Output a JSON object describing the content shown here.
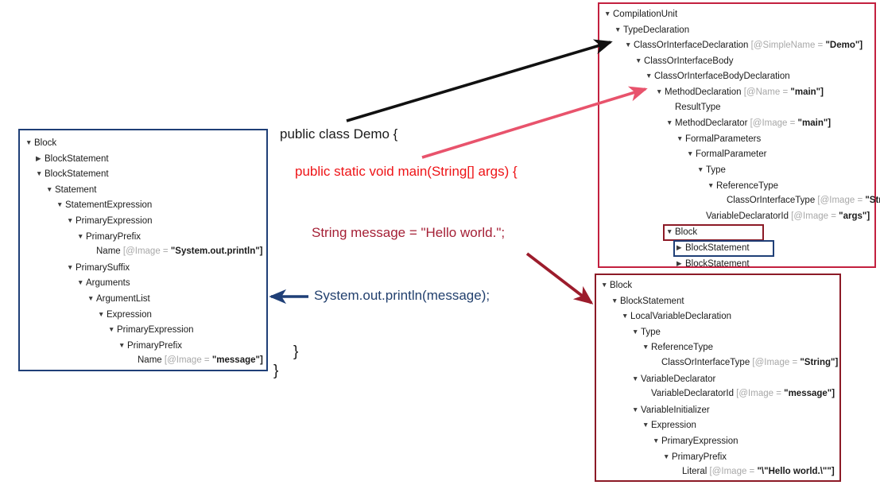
{
  "code_snippet": {
    "lines": [
      {
        "id": "line-class-decl",
        "text": "public class Demo {",
        "color": "#1b1b1b"
      },
      {
        "id": "line-main-method",
        "text": "public static void main(String[] args) {",
        "color": "#ee1417"
      },
      {
        "id": "line-string-message",
        "text": "String message = \"Hello world.\";",
        "color": "#a52036"
      },
      {
        "id": "line-println",
        "text": "System.out.println(message);",
        "color": "#22406e"
      },
      {
        "id": "line-close-inner",
        "text": "}",
        "color": "#1b1b1b"
      },
      {
        "id": "line-close-outer",
        "text": "}",
        "color": "#1b1b1b"
      }
    ]
  },
  "panels": {
    "left_block_tree": {
      "border_color": "#1f3f77",
      "rows": [
        {
          "indent": 0,
          "twisty": "expanded",
          "name": "Block",
          "attr": "",
          "value": ""
        },
        {
          "indent": 1,
          "twisty": "collapsed",
          "name": "BlockStatement",
          "attr": "",
          "value": ""
        },
        {
          "indent": 1,
          "twisty": "expanded",
          "name": "BlockStatement",
          "attr": "",
          "value": ""
        },
        {
          "indent": 2,
          "twisty": "expanded",
          "name": "Statement",
          "attr": "",
          "value": ""
        },
        {
          "indent": 3,
          "twisty": "expanded",
          "name": "StatementExpression",
          "attr": "",
          "value": ""
        },
        {
          "indent": 4,
          "twisty": "expanded",
          "name": "PrimaryExpression",
          "attr": "",
          "value": ""
        },
        {
          "indent": 5,
          "twisty": "expanded",
          "name": "PrimaryPrefix",
          "attr": "",
          "value": ""
        },
        {
          "indent": 6,
          "twisty": "none",
          "name": "Name",
          "attr": "[@Image = ",
          "value": "\"System.out.println\"]"
        },
        {
          "indent": 4,
          "twisty": "expanded",
          "name": "PrimarySuffix",
          "attr": "",
          "value": ""
        },
        {
          "indent": 5,
          "twisty": "expanded",
          "name": "Arguments",
          "attr": "",
          "value": ""
        },
        {
          "indent": 6,
          "twisty": "expanded",
          "name": "ArgumentList",
          "attr": "",
          "value": ""
        },
        {
          "indent": 7,
          "twisty": "expanded",
          "name": "Expression",
          "attr": "",
          "value": ""
        },
        {
          "indent": 8,
          "twisty": "expanded",
          "name": "PrimaryExpression",
          "attr": "",
          "value": ""
        },
        {
          "indent": 9,
          "twisty": "expanded",
          "name": "PrimaryPrefix",
          "attr": "",
          "value": ""
        },
        {
          "indent": 10,
          "twisty": "none",
          "name": "Name",
          "attr": "[@Image = ",
          "value": "\"message\"]"
        }
      ]
    },
    "top_right_compilation_unit": {
      "border_color": "#c3203f",
      "rows": [
        {
          "indent": 0,
          "twisty": "expanded",
          "name": "CompilationUnit",
          "attr": "",
          "value": ""
        },
        {
          "indent": 1,
          "twisty": "expanded",
          "name": "TypeDeclaration",
          "attr": "",
          "value": ""
        },
        {
          "indent": 2,
          "twisty": "expanded",
          "name": "ClassOrInterfaceDeclaration",
          "attr": "[@SimpleName = ",
          "value": "\"Demo\"]"
        },
        {
          "indent": 3,
          "twisty": "expanded",
          "name": "ClassOrInterfaceBody",
          "attr": "",
          "value": ""
        },
        {
          "indent": 4,
          "twisty": "expanded",
          "name": "ClassOrInterfaceBodyDeclaration",
          "attr": "",
          "value": ""
        },
        {
          "indent": 5,
          "twisty": "expanded",
          "name": "MethodDeclaration",
          "attr": "[@Name = ",
          "value": "\"main\"]"
        },
        {
          "indent": 6,
          "twisty": "none",
          "name": "ResultType",
          "attr": "",
          "value": ""
        },
        {
          "indent": 6,
          "twisty": "expanded",
          "name": "MethodDeclarator",
          "attr": "[@Image = ",
          "value": "\"main\"]"
        },
        {
          "indent": 7,
          "twisty": "expanded",
          "name": "FormalParameters",
          "attr": "",
          "value": ""
        },
        {
          "indent": 8,
          "twisty": "expanded",
          "name": "FormalParameter",
          "attr": "",
          "value": ""
        },
        {
          "indent": 9,
          "twisty": "expanded",
          "name": "Type",
          "attr": "",
          "value": ""
        },
        {
          "indent": 10,
          "twisty": "expanded",
          "name": "ReferenceType",
          "attr": "",
          "value": ""
        },
        {
          "indent": 11,
          "twisty": "none",
          "name": "ClassOrInterfaceType",
          "attr": "[@Image = ",
          "value": "\"String\"]"
        },
        {
          "indent": 9,
          "twisty": "none",
          "name": "VariableDeclaratorId",
          "attr": "[@Image = ",
          "value": "\"args\"]"
        },
        {
          "indent": 6,
          "twisty": "expanded",
          "name": "Block",
          "attr": "",
          "value": ""
        },
        {
          "indent": 7,
          "twisty": "collapsed",
          "name": "BlockStatement",
          "attr": "",
          "value": ""
        },
        {
          "indent": 7,
          "twisty": "collapsed",
          "name": "BlockStatement",
          "attr": "",
          "value": ""
        }
      ],
      "highlights": [
        {
          "id": "highlight-blockstatement-1",
          "color": "#8c1a26",
          "row": 15
        },
        {
          "id": "highlight-blockstatement-2",
          "color": "#1f3f77",
          "row": 16
        }
      ]
    },
    "bottom_right_local_var": {
      "border_color": "#8c1a26",
      "rows": [
        {
          "indent": 0,
          "twisty": "expanded",
          "name": "Block",
          "attr": "",
          "value": ""
        },
        {
          "indent": 1,
          "twisty": "expanded",
          "name": "BlockStatement",
          "attr": "",
          "value": ""
        },
        {
          "indent": 2,
          "twisty": "expanded",
          "name": "LocalVariableDeclaration",
          "attr": "",
          "value": ""
        },
        {
          "indent": 3,
          "twisty": "expanded",
          "name": "Type",
          "attr": "",
          "value": ""
        },
        {
          "indent": 4,
          "twisty": "expanded",
          "name": "ReferenceType",
          "attr": "",
          "value": ""
        },
        {
          "indent": 5,
          "twisty": "none",
          "name": "ClassOrInterfaceType",
          "attr": "[@Image = ",
          "value": "\"String\"]"
        },
        {
          "indent": 3,
          "twisty": "expanded",
          "name": "VariableDeclarator",
          "attr": "",
          "value": ""
        },
        {
          "indent": 4,
          "twisty": "none",
          "name": "VariableDeclaratorId",
          "attr": "[@Image = ",
          "value": "\"message\"]"
        },
        {
          "indent": 3,
          "twisty": "expanded",
          "name": "VariableInitializer",
          "attr": "",
          "value": ""
        },
        {
          "indent": 4,
          "twisty": "expanded",
          "name": "Expression",
          "attr": "",
          "value": ""
        },
        {
          "indent": 5,
          "twisty": "expanded",
          "name": "PrimaryExpression",
          "attr": "",
          "value": ""
        },
        {
          "indent": 6,
          "twisty": "expanded",
          "name": "PrimaryPrefix",
          "attr": "",
          "value": ""
        },
        {
          "indent": 7,
          "twisty": "none",
          "name": "Literal",
          "attr": "[@Image = ",
          "value": "\"\\\"Hello world.\\\"\"]"
        }
      ]
    }
  },
  "arrows": [
    {
      "id": "arrow-class-to-classdecl",
      "color": "#111111",
      "label": "black-arrow-to-ClassOrInterfaceDeclaration"
    },
    {
      "id": "arrow-main-to-methoddecl",
      "color": "#e8536c",
      "label": "pink-arrow-to-MethodDeclaration"
    },
    {
      "id": "arrow-string-to-localvar",
      "color": "#9c1c2c",
      "label": "darkred-arrow-to-Block"
    },
    {
      "id": "arrow-println-to-blocktree",
      "color": "#1f3f77",
      "label": "navy-arrow-to-Block"
    }
  ],
  "twisty_glyphs": {
    "expanded": "▼",
    "collapsed": "▶",
    "none": ""
  }
}
